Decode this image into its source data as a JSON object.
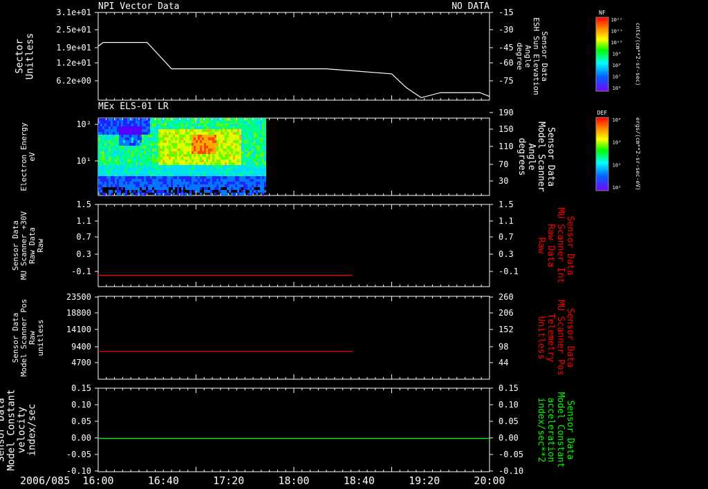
{
  "date": "2006/085",
  "time_labels": [
    "16:00",
    "16:40",
    "17:20",
    "18:00",
    "18:40",
    "19:20",
    "20:00"
  ],
  "time_range_hours": [
    16.0,
    20.0
  ],
  "panels": [
    {
      "title": "NPI Vector Data",
      "status": "NO DATA",
      "left_label": [
        "Sector",
        "Unitless"
      ],
      "left_ticks": [
        "3.1e+01",
        "2.5e+01",
        "1.9e+01",
        "1.2e+01",
        "6.2e+00"
      ],
      "right_ticks": [
        "-15",
        "-30",
        "-45",
        "-60",
        "-75"
      ],
      "right_label": [
        "Sensor Data",
        "ESH Sun Elevation",
        "Angle",
        "degree"
      ],
      "right_label_color": "#ffffff",
      "line_color": "#ffffff"
    },
    {
      "title": "MEx ELS-01 LR",
      "left_label": [
        "Electron Energy",
        "eV"
      ],
      "left_ticks": [
        "10²",
        "10¹"
      ],
      "right_ticks": [
        "190",
        "150",
        "110",
        "70",
        "30"
      ],
      "right_label": [
        "Sensor Data",
        "Model Scanner",
        "Angle",
        "degrees"
      ],
      "right_label_color": "#ffffff"
    },
    {
      "left_label": [
        "Sensor Data",
        "MU Scanner +30V",
        "Raw Data",
        "Raw"
      ],
      "left_ticks": [
        "1.5",
        "1.1",
        "0.7",
        "0.3",
        "-0.1"
      ],
      "right_ticks": [
        "1.5",
        "1.1",
        "0.7",
        "0.3",
        "-0.1"
      ],
      "right_label": [
        "Sensor Data",
        "MU Scanner Int",
        "Raw Data",
        "Raw"
      ],
      "right_label_color": "#ff0000",
      "line_color": "#ff0000"
    },
    {
      "left_label": [
        "Sensor Data",
        "Model Scanner Pos",
        "Raw",
        "unitless"
      ],
      "left_ticks": [
        "23500",
        "18800",
        "14100",
        "9400",
        "4700"
      ],
      "right_ticks": [
        "260",
        "206",
        "152",
        "98",
        "44"
      ],
      "right_label": [
        "Sensor Data",
        "MU Scanner Pos",
        "Telemetry",
        "Unitless"
      ],
      "right_label_color": "#ff0000",
      "line_color": "#ff0000"
    },
    {
      "left_label": [
        "Sensor Data",
        "Model Constant",
        "velocity",
        "index/sec"
      ],
      "left_ticks": [
        "0.15",
        "0.10",
        "0.05",
        "0.00",
        "-0.05",
        "-0.10"
      ],
      "right_ticks": [
        "0.15",
        "0.10",
        "0.05",
        "0.00",
        "-0.05",
        "-0.10"
      ],
      "right_label": [
        "Sensor Data",
        "Model Constant",
        "acceleration",
        "index/sec**2"
      ],
      "right_label_color": "#00ff00",
      "line_color": "#00ff00"
    }
  ],
  "colorbars": [
    {
      "label": "NF",
      "ticks": [
        "10¹²",
        "10¹¹",
        "10¹⁰",
        "10⁹",
        "10⁸",
        "10⁷",
        "10⁶"
      ],
      "units": "cnts/(cm**2-sr-sec)"
    },
    {
      "label": "DEF",
      "ticks": [
        "10⁴",
        "10³",
        "10²",
        "10¹"
      ],
      "units": "ergs/(cm**2-sr-sec-eV)"
    }
  ],
  "chart_data": [
    {
      "type": "line",
      "title": "NPI Vector Data",
      "ylabel": "Sector Unitless",
      "y2label": "Sensor Data ESH Sun Elevation Angle degree",
      "y2lim": [
        -85,
        -15
      ],
      "series": [
        {
          "x": [
            16.0,
            16.05,
            16.5,
            16.75,
            18.33,
            19.0,
            19.15,
            19.3,
            19.5,
            19.9,
            20.0
          ],
          "values": [
            -42,
            -39,
            -39,
            -60,
            -60,
            -64,
            -75,
            -83,
            -79,
            -79,
            -82
          ]
        }
      ]
    },
    {
      "type": "heatmap",
      "title": "MEx ELS-01 LR",
      "ylabel": "Electron Energy eV",
      "y2label": "Sensor Data Model Scanner Angle degrees",
      "x_extent": [
        16.0,
        17.7
      ],
      "y2lim": [
        10,
        190
      ]
    },
    {
      "type": "line",
      "ylabel": "Sensor Data MU Scanner +30V Raw Data Raw",
      "ylim": [
        -0.3,
        1.5
      ],
      "series": [
        {
          "x": [
            16.0,
            18.6
          ],
          "values": [
            -0.05,
            -0.05
          ]
        }
      ]
    },
    {
      "type": "line",
      "ylabel": "Sensor Data Model Scanner Pos Raw unitless",
      "ylim": [
        0,
        23500
      ],
      "series": [
        {
          "x": [
            16.0,
            18.6
          ],
          "values": [
            7900,
            7900
          ]
        }
      ]
    },
    {
      "type": "line",
      "ylabel": "Sensor Data Model Constant velocity index/sec",
      "ylim": [
        -0.1,
        0.15
      ],
      "series": [
        {
          "x": [
            16.0,
            20.0
          ],
          "values": [
            0.0,
            0.0
          ]
        }
      ]
    }
  ]
}
